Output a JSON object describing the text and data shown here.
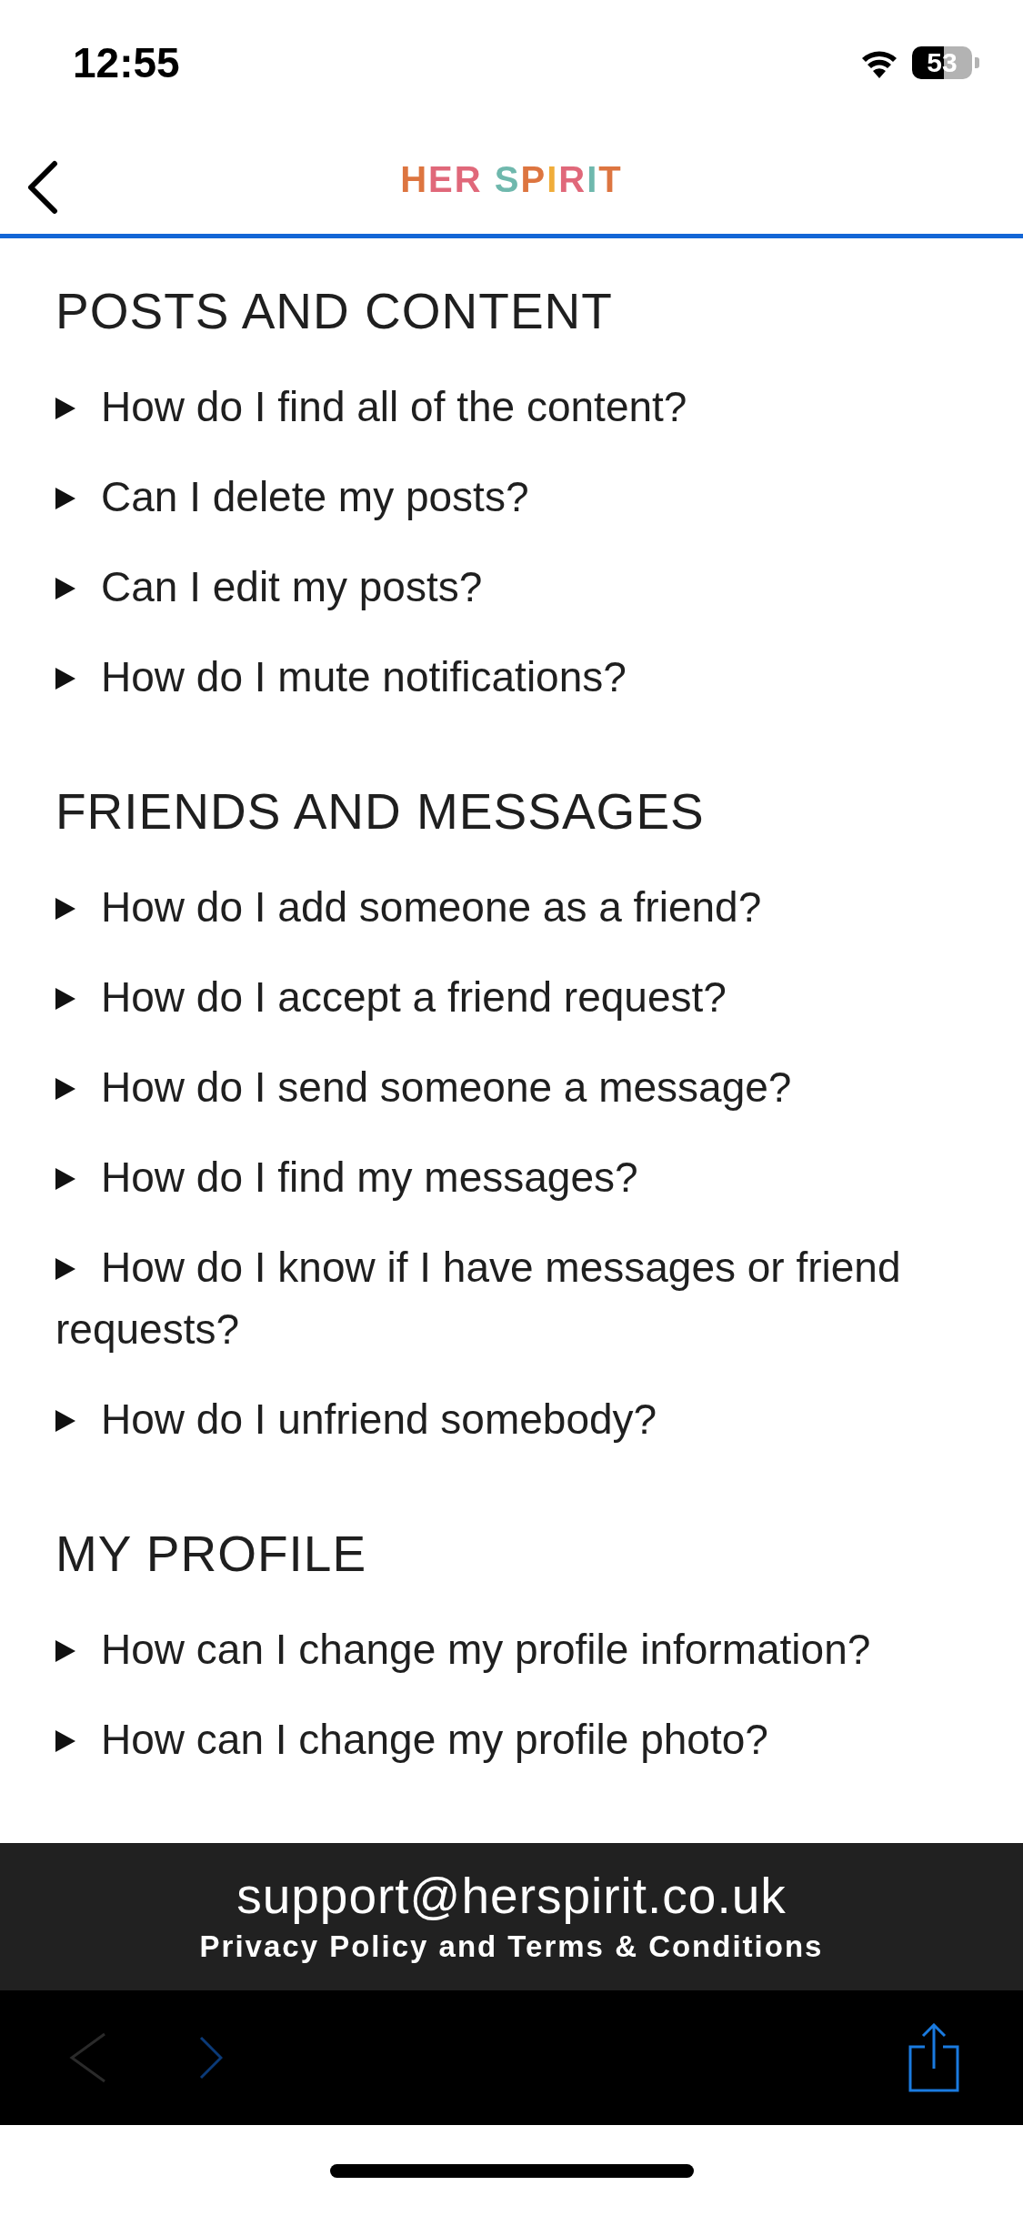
{
  "status_bar": {
    "time": "12:55",
    "battery": "53"
  },
  "nav_bar": {
    "logo": "HER SPIRIT"
  },
  "sections": [
    {
      "title": "POSTS AND CONTENT",
      "items": [
        {
          "question": "How do I find all of the content?",
          "expanded": false
        },
        {
          "question": "Can I delete my posts?",
          "expanded": false
        },
        {
          "question": "Can I edit my posts?",
          "expanded": false
        },
        {
          "question": "How do I mute notifications?",
          "expanded": false
        }
      ]
    },
    {
      "title": "FRIENDS AND MESSAGES",
      "items": [
        {
          "question": "How do I add someone as a friend?",
          "expanded": false
        },
        {
          "question": "How do I accept a friend request?",
          "expanded": false
        },
        {
          "question": "How do I send someone a message?",
          "expanded": false
        },
        {
          "question": "How do I find my messages?",
          "expanded": false
        },
        {
          "question": "How do I know if I have messages or friend requests?",
          "expanded": false
        },
        {
          "question": "How do I unfriend somebody?",
          "expanded": false
        }
      ]
    },
    {
      "title": "MY PROFILE",
      "items": [
        {
          "question": "How can I change my profile information?",
          "expanded": false
        },
        {
          "question": "How can I change my profile photo?",
          "expanded": false
        }
      ]
    }
  ],
  "footer": {
    "email": "support@herspirit.co.uk",
    "links": "Privacy Policy and Terms & Conditions"
  }
}
